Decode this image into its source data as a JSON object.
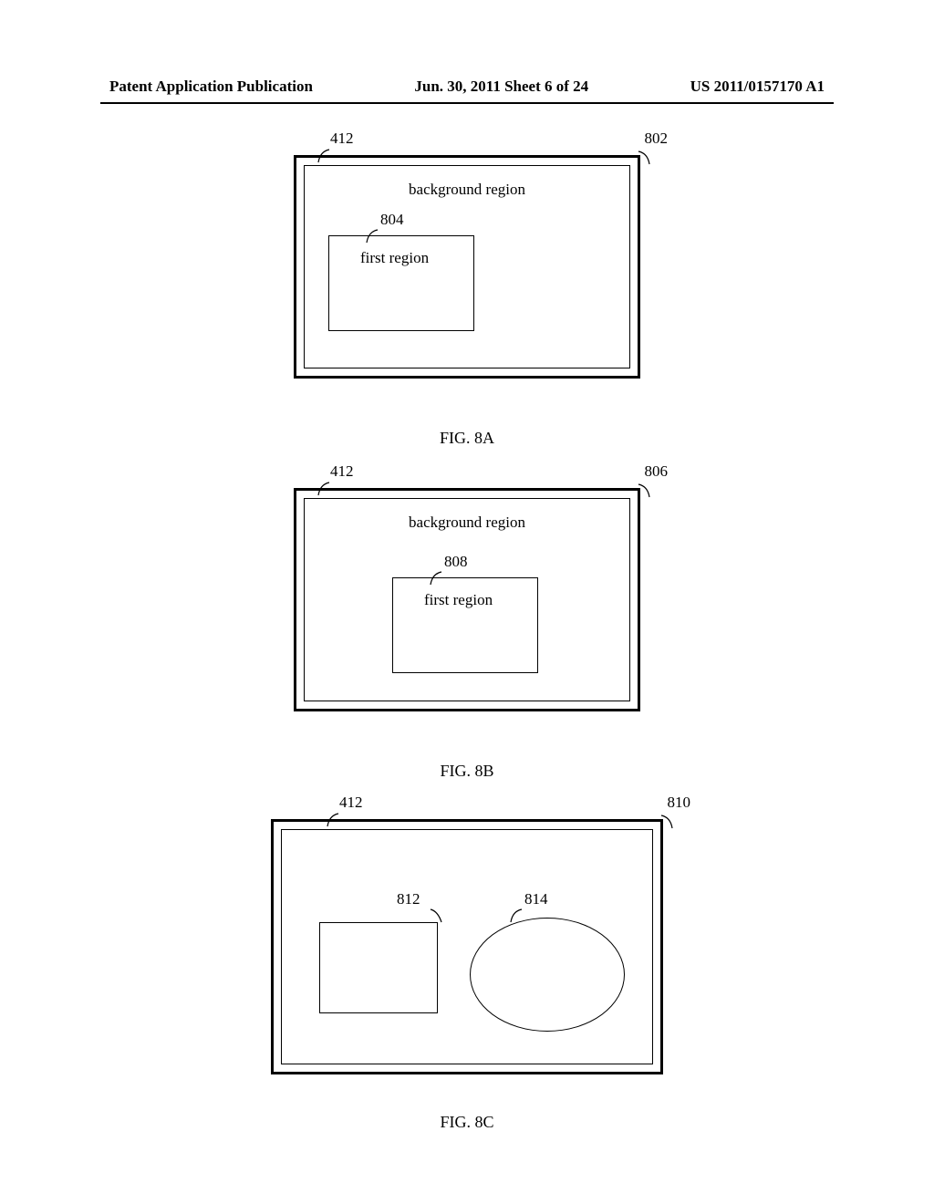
{
  "header": {
    "left": "Patent Application Publication",
    "center": "Jun. 30, 2011  Sheet 6 of 24",
    "right": "US 2011/0157170 A1"
  },
  "fig8a": {
    "label_412": "412",
    "label_802": "802",
    "label_804": "804",
    "background_text": "background region",
    "first_region_text": "first region",
    "caption": "FIG. 8A"
  },
  "fig8b": {
    "label_412": "412",
    "label_806": "806",
    "label_808": "808",
    "background_text": "background region",
    "first_region_text": "first region",
    "caption": "FIG. 8B"
  },
  "fig8c": {
    "label_412": "412",
    "label_810": "810",
    "label_812": "812",
    "label_814": "814",
    "caption": "FIG. 8C"
  }
}
